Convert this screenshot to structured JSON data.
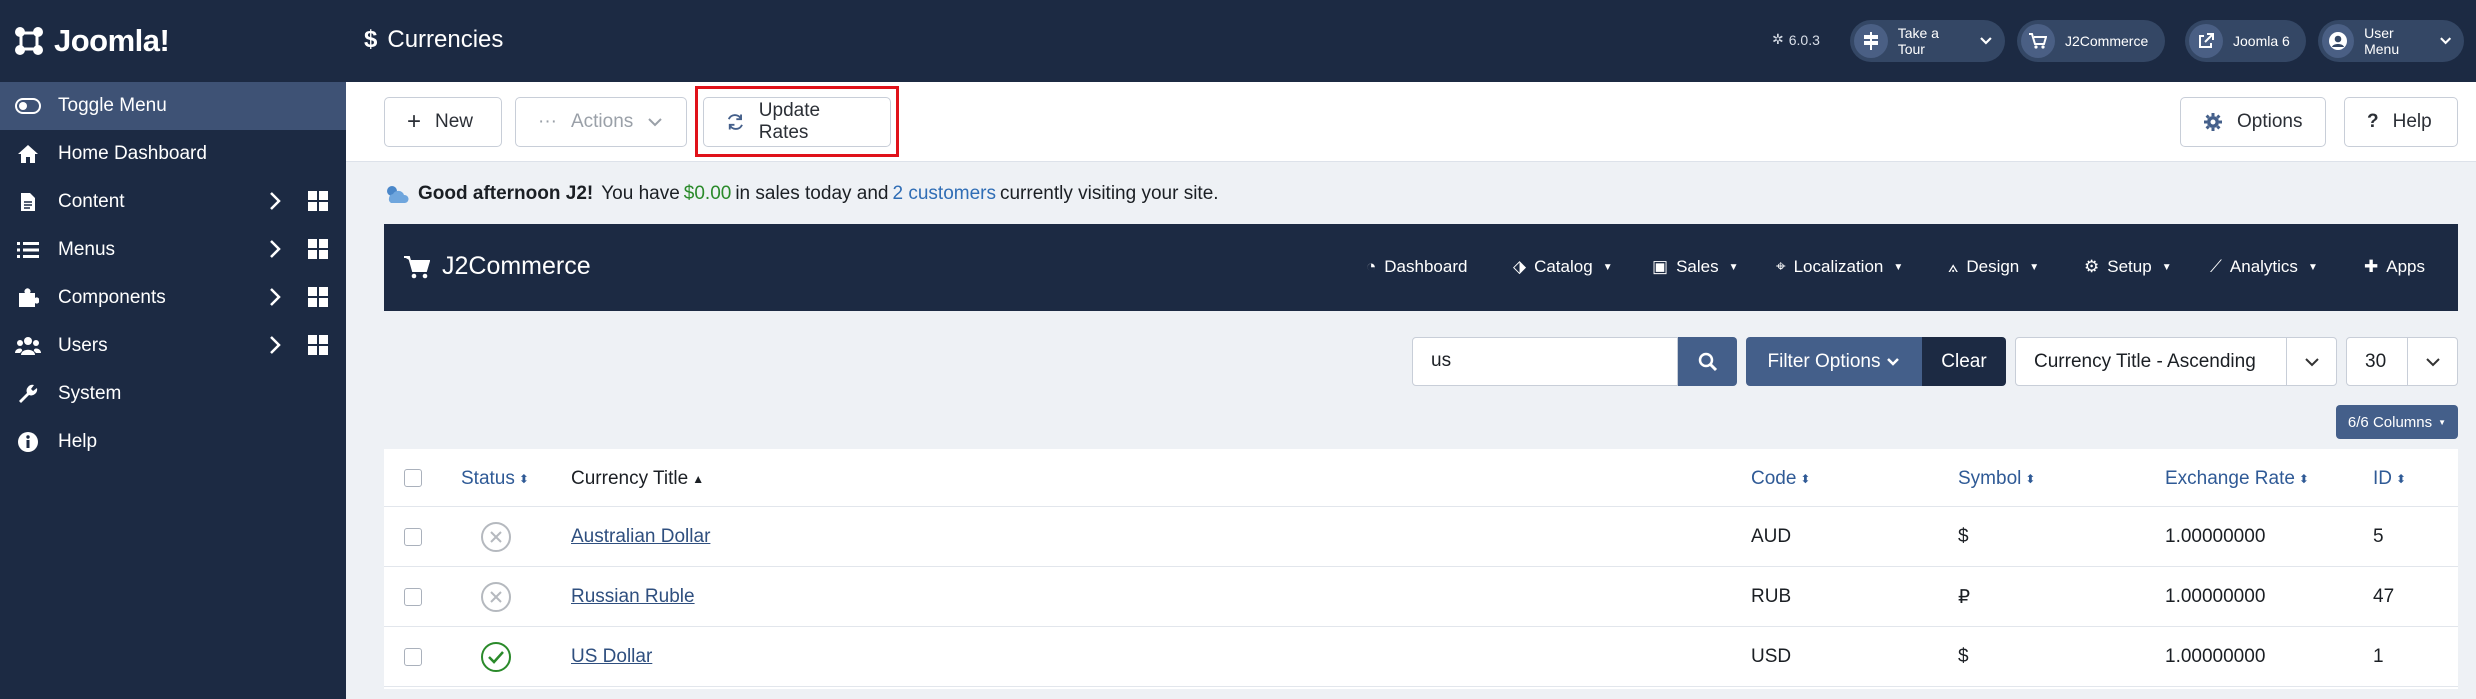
{
  "brand": {
    "name": "Joomla!"
  },
  "sidebar": {
    "items": [
      {
        "label": "Toggle Menu",
        "icon": "toggle-icon"
      },
      {
        "label": "Home Dashboard",
        "icon": "home-icon"
      },
      {
        "label": "Content",
        "icon": "file-icon"
      },
      {
        "label": "Menus",
        "icon": "list-icon"
      },
      {
        "label": "Components",
        "icon": "puzzle-icon"
      },
      {
        "label": "Users",
        "icon": "users-icon"
      },
      {
        "label": "System",
        "icon": "wrench-icon"
      },
      {
        "label": "Help",
        "icon": "info-icon"
      }
    ]
  },
  "header": {
    "title": "Currencies",
    "version": "6.0.3",
    "tour_label": "Take a Tour",
    "j2commerce_label": "J2Commerce",
    "joomla_label": "Joomla 6",
    "user_label": "User Menu"
  },
  "toolbar": {
    "new_label": "New",
    "actions_label": "Actions",
    "update_rates_label": "Update Rates",
    "options_label": "Options",
    "help_label": "Help"
  },
  "greeting": {
    "bold": "Good afternoon J2!",
    "t1": "You have",
    "sales": "$0.00",
    "t2": "in sales today and",
    "customers": "2 customers",
    "t3": "currently visiting your site."
  },
  "j2": {
    "brand": "J2Commerce",
    "nav": {
      "dashboard": "Dashboard",
      "catalog": "Catalog",
      "sales": "Sales",
      "localization": "Localization",
      "design": "Design",
      "setup": "Setup",
      "analytics": "Analytics",
      "apps": "Apps"
    }
  },
  "filters": {
    "search_value": "us",
    "filter_options_label": "Filter Options",
    "clear_label": "Clear",
    "sort_value": "Currency Title - Ascending",
    "limit_value": "30",
    "columns_label": "6/6 Columns"
  },
  "table": {
    "headers": {
      "status": "Status",
      "title": "Currency Title",
      "code": "Code",
      "symbol": "Symbol",
      "rate": "Exchange Rate",
      "id": "ID"
    },
    "rows": [
      {
        "status": "unpublished",
        "title": "Australian Dollar",
        "code": "AUD",
        "symbol": "$",
        "rate": "1.00000000",
        "id": "5"
      },
      {
        "status": "unpublished",
        "title": "Russian Ruble",
        "code": "RUB",
        "symbol": "₽",
        "rate": "1.00000000",
        "id": "47"
      },
      {
        "status": "published",
        "title": "US Dollar",
        "code": "USD",
        "symbol": "$",
        "rate": "1.00000000",
        "id": "1"
      }
    ]
  },
  "colors": {
    "navy": "#1c2a43",
    "accent": "#445f8a",
    "highlight": "#e0121a",
    "published": "#2a8a2a"
  }
}
